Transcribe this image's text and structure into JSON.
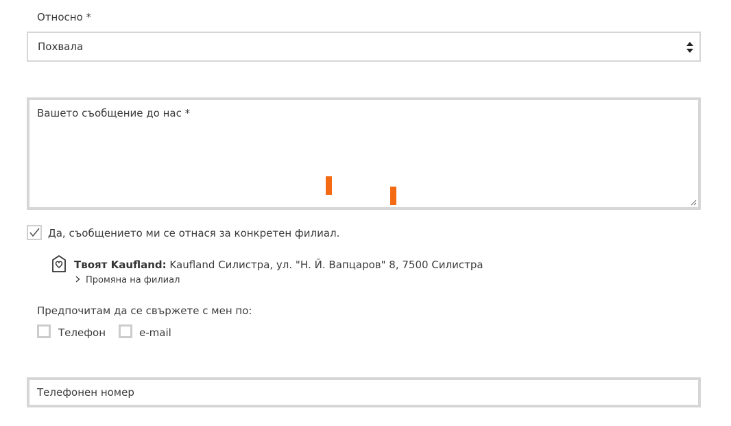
{
  "form": {
    "subject_label": "Относно  *",
    "subject_value": "Похвала",
    "message_label": "Вашето съобщение до нас  *",
    "branch_checkbox_label": "Да, съобщението ми се отнася за конкретен филиал.",
    "branch_checked": true,
    "store_prefix": "Твоят Kaufland:",
    "store_address": " Kaufland Силистра, ул. \"Н. Й. Вапцаров\" 8, 7500 Силистра",
    "change_store_label": "Промяна на филиал",
    "contact_pref_label": "Предпочитам да се свържете с мен по:",
    "contact_options": [
      {
        "label": "Телефон",
        "checked": false
      },
      {
        "label": "e-mail",
        "checked": false
      }
    ],
    "phone_placeholder": "Телефонен номер"
  },
  "colors": {
    "accent": "#f36a12",
    "border": "#d6d6d6",
    "text": "#3b3b3b"
  }
}
